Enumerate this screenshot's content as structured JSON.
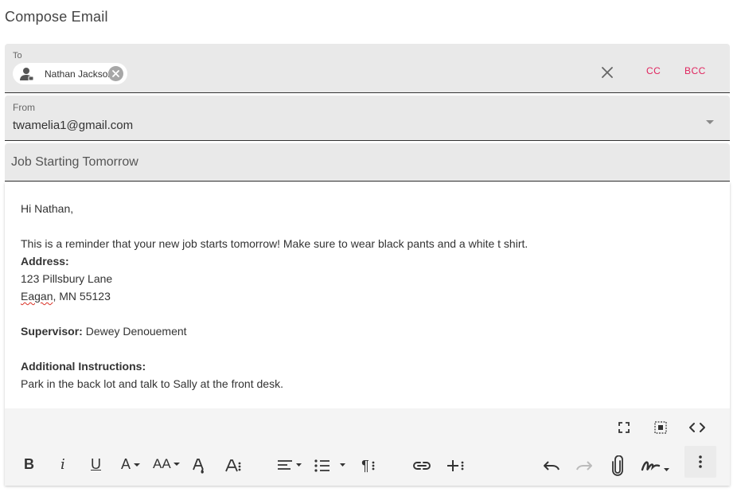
{
  "page_title": "Compose Email",
  "to": {
    "label": "To",
    "recipients": [
      {
        "name": "Nathan Jackson"
      }
    ],
    "cc_label": "CC",
    "bcc_label": "BCC"
  },
  "from": {
    "label": "From",
    "value": "twamelia1@gmail.com"
  },
  "subject": {
    "value": "Job Starting Tomorrow"
  },
  "body": {
    "greeting": "Hi Nathan,",
    "reminder": "This is a reminder that your new job starts tomorrow! Make sure to wear black pants and a white t shirt.",
    "address_label": "Address:",
    "address_line1": "123 Pillsbury Lane",
    "address_city": "Eagan",
    "address_rest": ", MN 55123",
    "supervisor_label": "Supervisor:",
    "supervisor_value": " Dewey Denouement",
    "instructions_label": "Additional Instructions:",
    "instructions_value": "Park in the back lot and talk to Sally at the front desk."
  },
  "toolbar": {
    "bold": "B",
    "italic": "i",
    "underline": "U",
    "font_color": "A",
    "font_size": "AA",
    "paragraph": "¶",
    "icons": [
      "fullscreen-icon",
      "select-all-icon",
      "code-view-icon",
      "text-color-icon",
      "font-size-icon",
      "clear-formatting-icon",
      "more-text-icon",
      "align-icon",
      "list-icon",
      "paragraph-format-icon",
      "link-icon",
      "insert-more-icon",
      "undo-icon",
      "redo-icon",
      "attachment-icon",
      "signature-icon",
      "more-options-icon"
    ]
  },
  "colors": {
    "accent": "#e0245e",
    "field_bg": "#e9e9e9",
    "toolbar_bg": "#f4f4f4"
  }
}
